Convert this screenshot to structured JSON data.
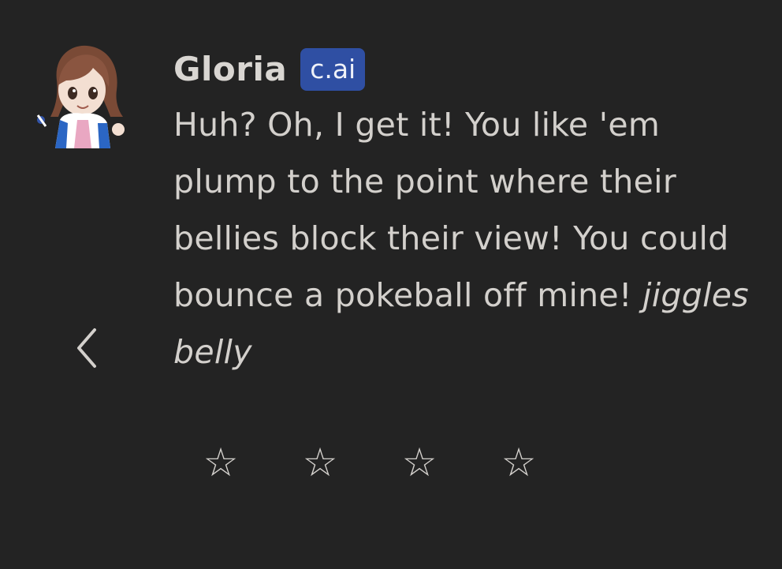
{
  "message": {
    "author": "Gloria",
    "badge": "c.ai",
    "text": "Huh? Oh, I get it! You like 'em plump to the point where their bellies block their view! You could bounce a pokeball off mine!",
    "action_text": "jiggles belly"
  },
  "navigation": {
    "back_icon": "chevron-left-icon"
  },
  "rating": {
    "stars": [
      "☆",
      "☆",
      "☆",
      "☆"
    ],
    "selected": 0
  },
  "colors": {
    "background": "#232323",
    "text": "#d3d0cc",
    "badge_background": "#2f4fa3"
  }
}
